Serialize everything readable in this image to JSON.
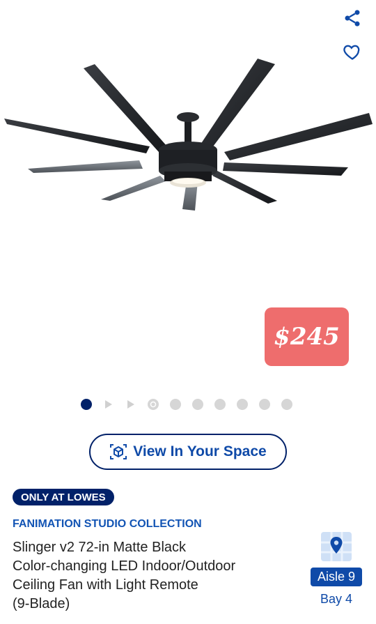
{
  "icons": {
    "share": "share-icon",
    "favorite": "heart-outline-icon",
    "ar": "ar-cube-icon",
    "map": "map-pin-icon"
  },
  "price": "$245",
  "carousel": {
    "total": 10,
    "active_index": 0
  },
  "view_space_label": "View In Your Space",
  "badge": "ONLY AT LOWES",
  "brand": "FANIMATION STUDIO COLLECTION",
  "title_lines": [
    "Slinger v2 72-in Matte Black",
    "Color-changing LED Indoor/Outdoor",
    "Ceiling Fan with Light Remote",
    "(9-Blade)"
  ],
  "location": {
    "aisle": "Aisle 9",
    "bay": "Bay 4"
  },
  "colors": {
    "brand_navy": "#012169",
    "link_blue": "#0f4aa8",
    "price_red": "#ee6d6d"
  }
}
